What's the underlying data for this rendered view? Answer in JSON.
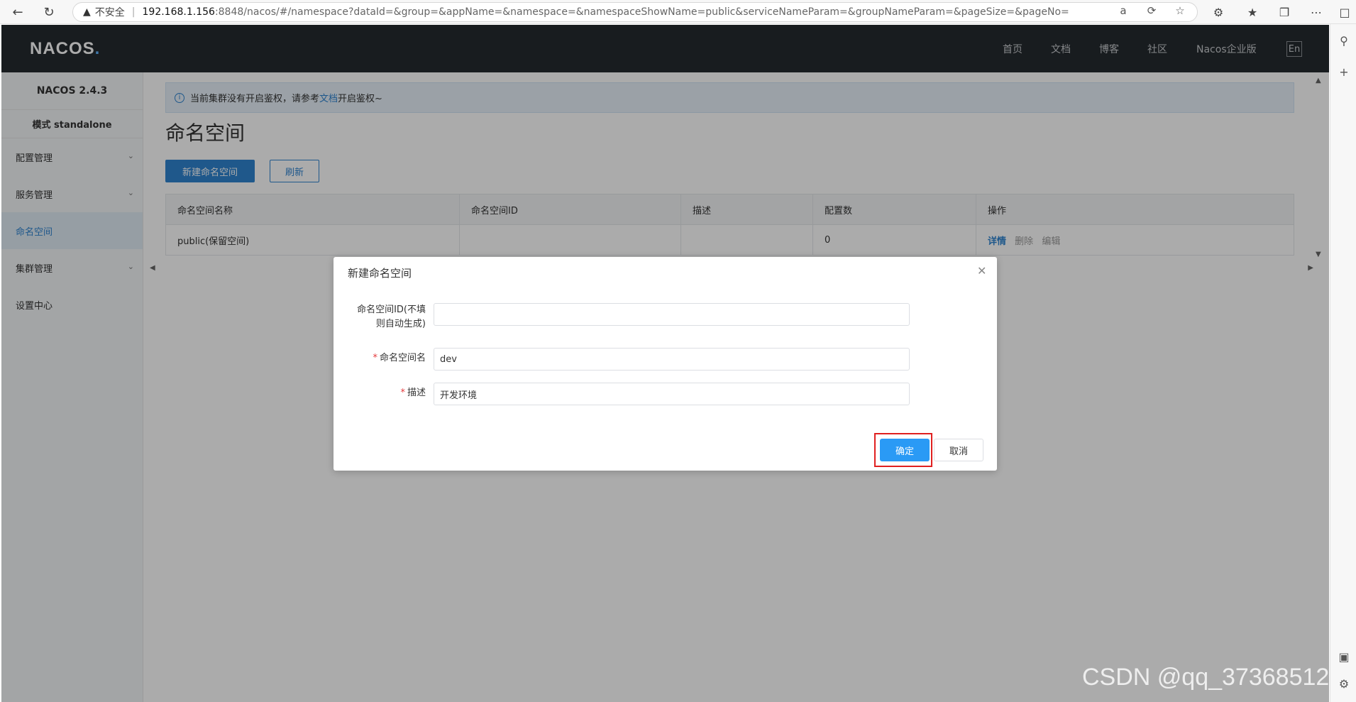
{
  "browser": {
    "insecure_label": "不安全",
    "url_host": "192.168.1.156",
    "url_path": ":8848/nacos/#/namespace?dataId=&group=&appName=&namespace=&namespaceShowName=public&serviceNameParam=&groupNameParam=&pageSize=&pageNo="
  },
  "header": {
    "logo": "NACOS",
    "logo_dot": ".",
    "nav": [
      "首页",
      "文档",
      "博客",
      "社区",
      "Nacos企业版"
    ],
    "lang": "En"
  },
  "sidebar": {
    "version": "NACOS 2.4.3",
    "mode": "模式 standalone",
    "items": [
      {
        "label": "配置管理",
        "expandable": true
      },
      {
        "label": "服务管理",
        "expandable": true
      },
      {
        "label": "命名空间",
        "active": true
      },
      {
        "label": "集群管理",
        "expandable": true
      },
      {
        "label": "设置中心"
      }
    ]
  },
  "notice": {
    "before": "当前集群没有开启鉴权，请参考",
    "link": "文档",
    "after": "开启鉴权~"
  },
  "page": {
    "title": "命名空间",
    "create_button": "新建命名空间",
    "refresh_button": "刷新"
  },
  "table": {
    "headers": [
      "命名空间名称",
      "命名空间ID",
      "描述",
      "配置数",
      "操作"
    ],
    "rows": [
      {
        "name": "public(保留空间)",
        "id": "",
        "desc": "",
        "count": "0"
      }
    ],
    "ops": [
      "详情",
      "删除",
      "编辑"
    ]
  },
  "dialog": {
    "title": "新建命名空间",
    "id_label_line1": "命名空间ID(不填",
    "id_label_line2": "则自动生成)",
    "id_value": "",
    "name_label": "命名空间名",
    "name_value": "dev",
    "desc_label": "描述",
    "desc_value": "开发环境",
    "ok": "确定",
    "cancel": "取消"
  },
  "watermark": "CSDN @qq_37368512",
  "colors": {
    "header_bg": "#252a2f",
    "primary": "#2f83d0",
    "ok_button": "#2a9af5",
    "highlight": "#e02020"
  }
}
